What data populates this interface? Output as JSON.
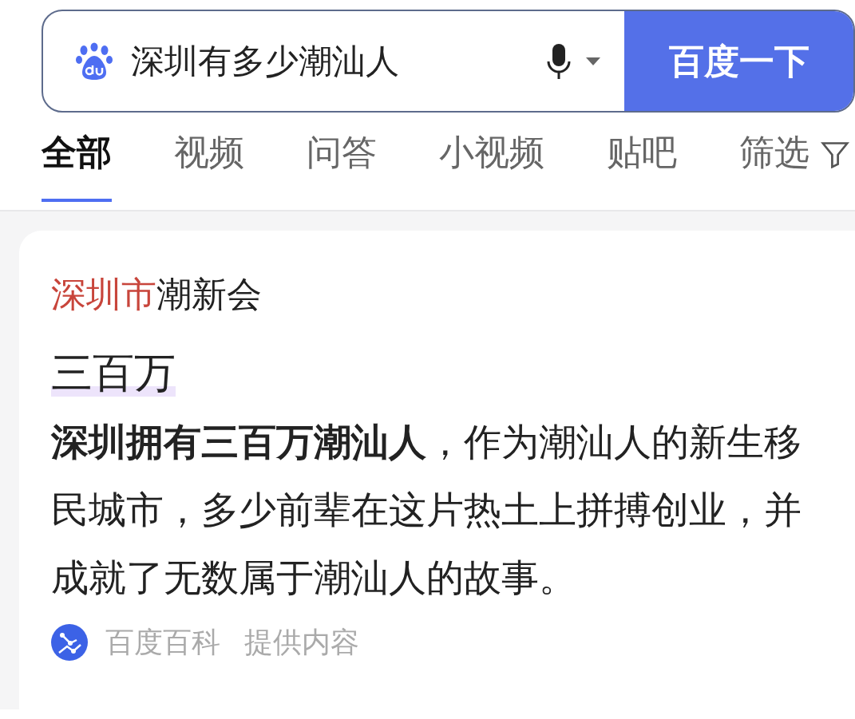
{
  "search": {
    "value": "深圳有多少潮汕人",
    "button": "百度一下"
  },
  "tabs": [
    {
      "label": "全部",
      "selected": true
    },
    {
      "label": "视频",
      "selected": false
    },
    {
      "label": "问答",
      "selected": false
    },
    {
      "label": "小视频",
      "selected": false
    },
    {
      "label": "贴吧",
      "selected": false
    },
    {
      "label": "筛选",
      "selected": false
    }
  ],
  "result": {
    "title": [
      {
        "text": "深圳市",
        "highlight": true
      },
      {
        "text": "潮新会",
        "highlight": false
      }
    ],
    "answer": "三百万",
    "snippet": "**深圳拥有三百万潮汕人**，作为潮汕人的新生移民城市，多少前辈在这片热土上拼搏创业，并成就了无数属于潮汕人的故事。",
    "source": "百度百科",
    "source_note": "提供内容"
  }
}
